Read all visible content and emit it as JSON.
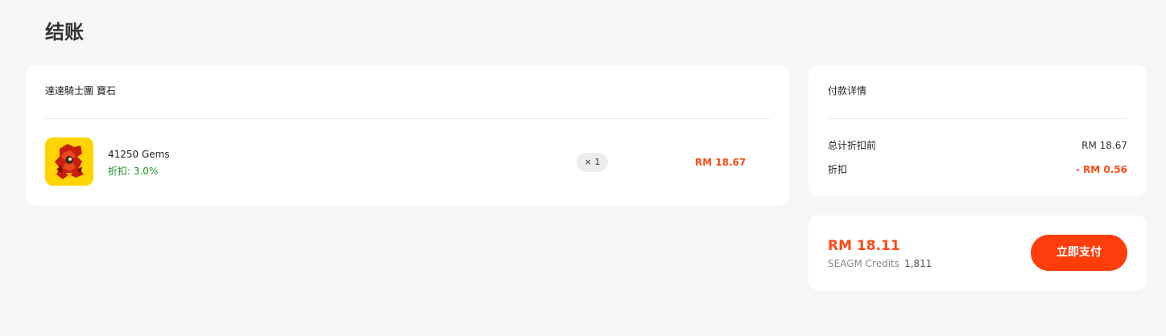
{
  "page": {
    "title": "结账"
  },
  "product_card": {
    "header": "達達騎士團 寶石",
    "item": {
      "name": "41250 Gems",
      "discount": "折扣: 3.0%",
      "quantity": "× 1",
      "price": "RM 18.67"
    }
  },
  "payment_details": {
    "header": "付款详情",
    "subtotal_label": "总计折扣前",
    "subtotal_value": "RM 18.67",
    "discount_label": "折扣",
    "discount_value": "- RM 0.56"
  },
  "total": {
    "amount": "RM 18.11",
    "credits_label": "SEAGM Credits",
    "credits_value": "1,811",
    "pay_button": "立即支付"
  },
  "colors": {
    "accent": "#ff4a16",
    "discount_green": "#1e8e2a",
    "product_bg": "#ffd400"
  },
  "icons": {
    "product": "dragon-knight-gem-icon"
  }
}
